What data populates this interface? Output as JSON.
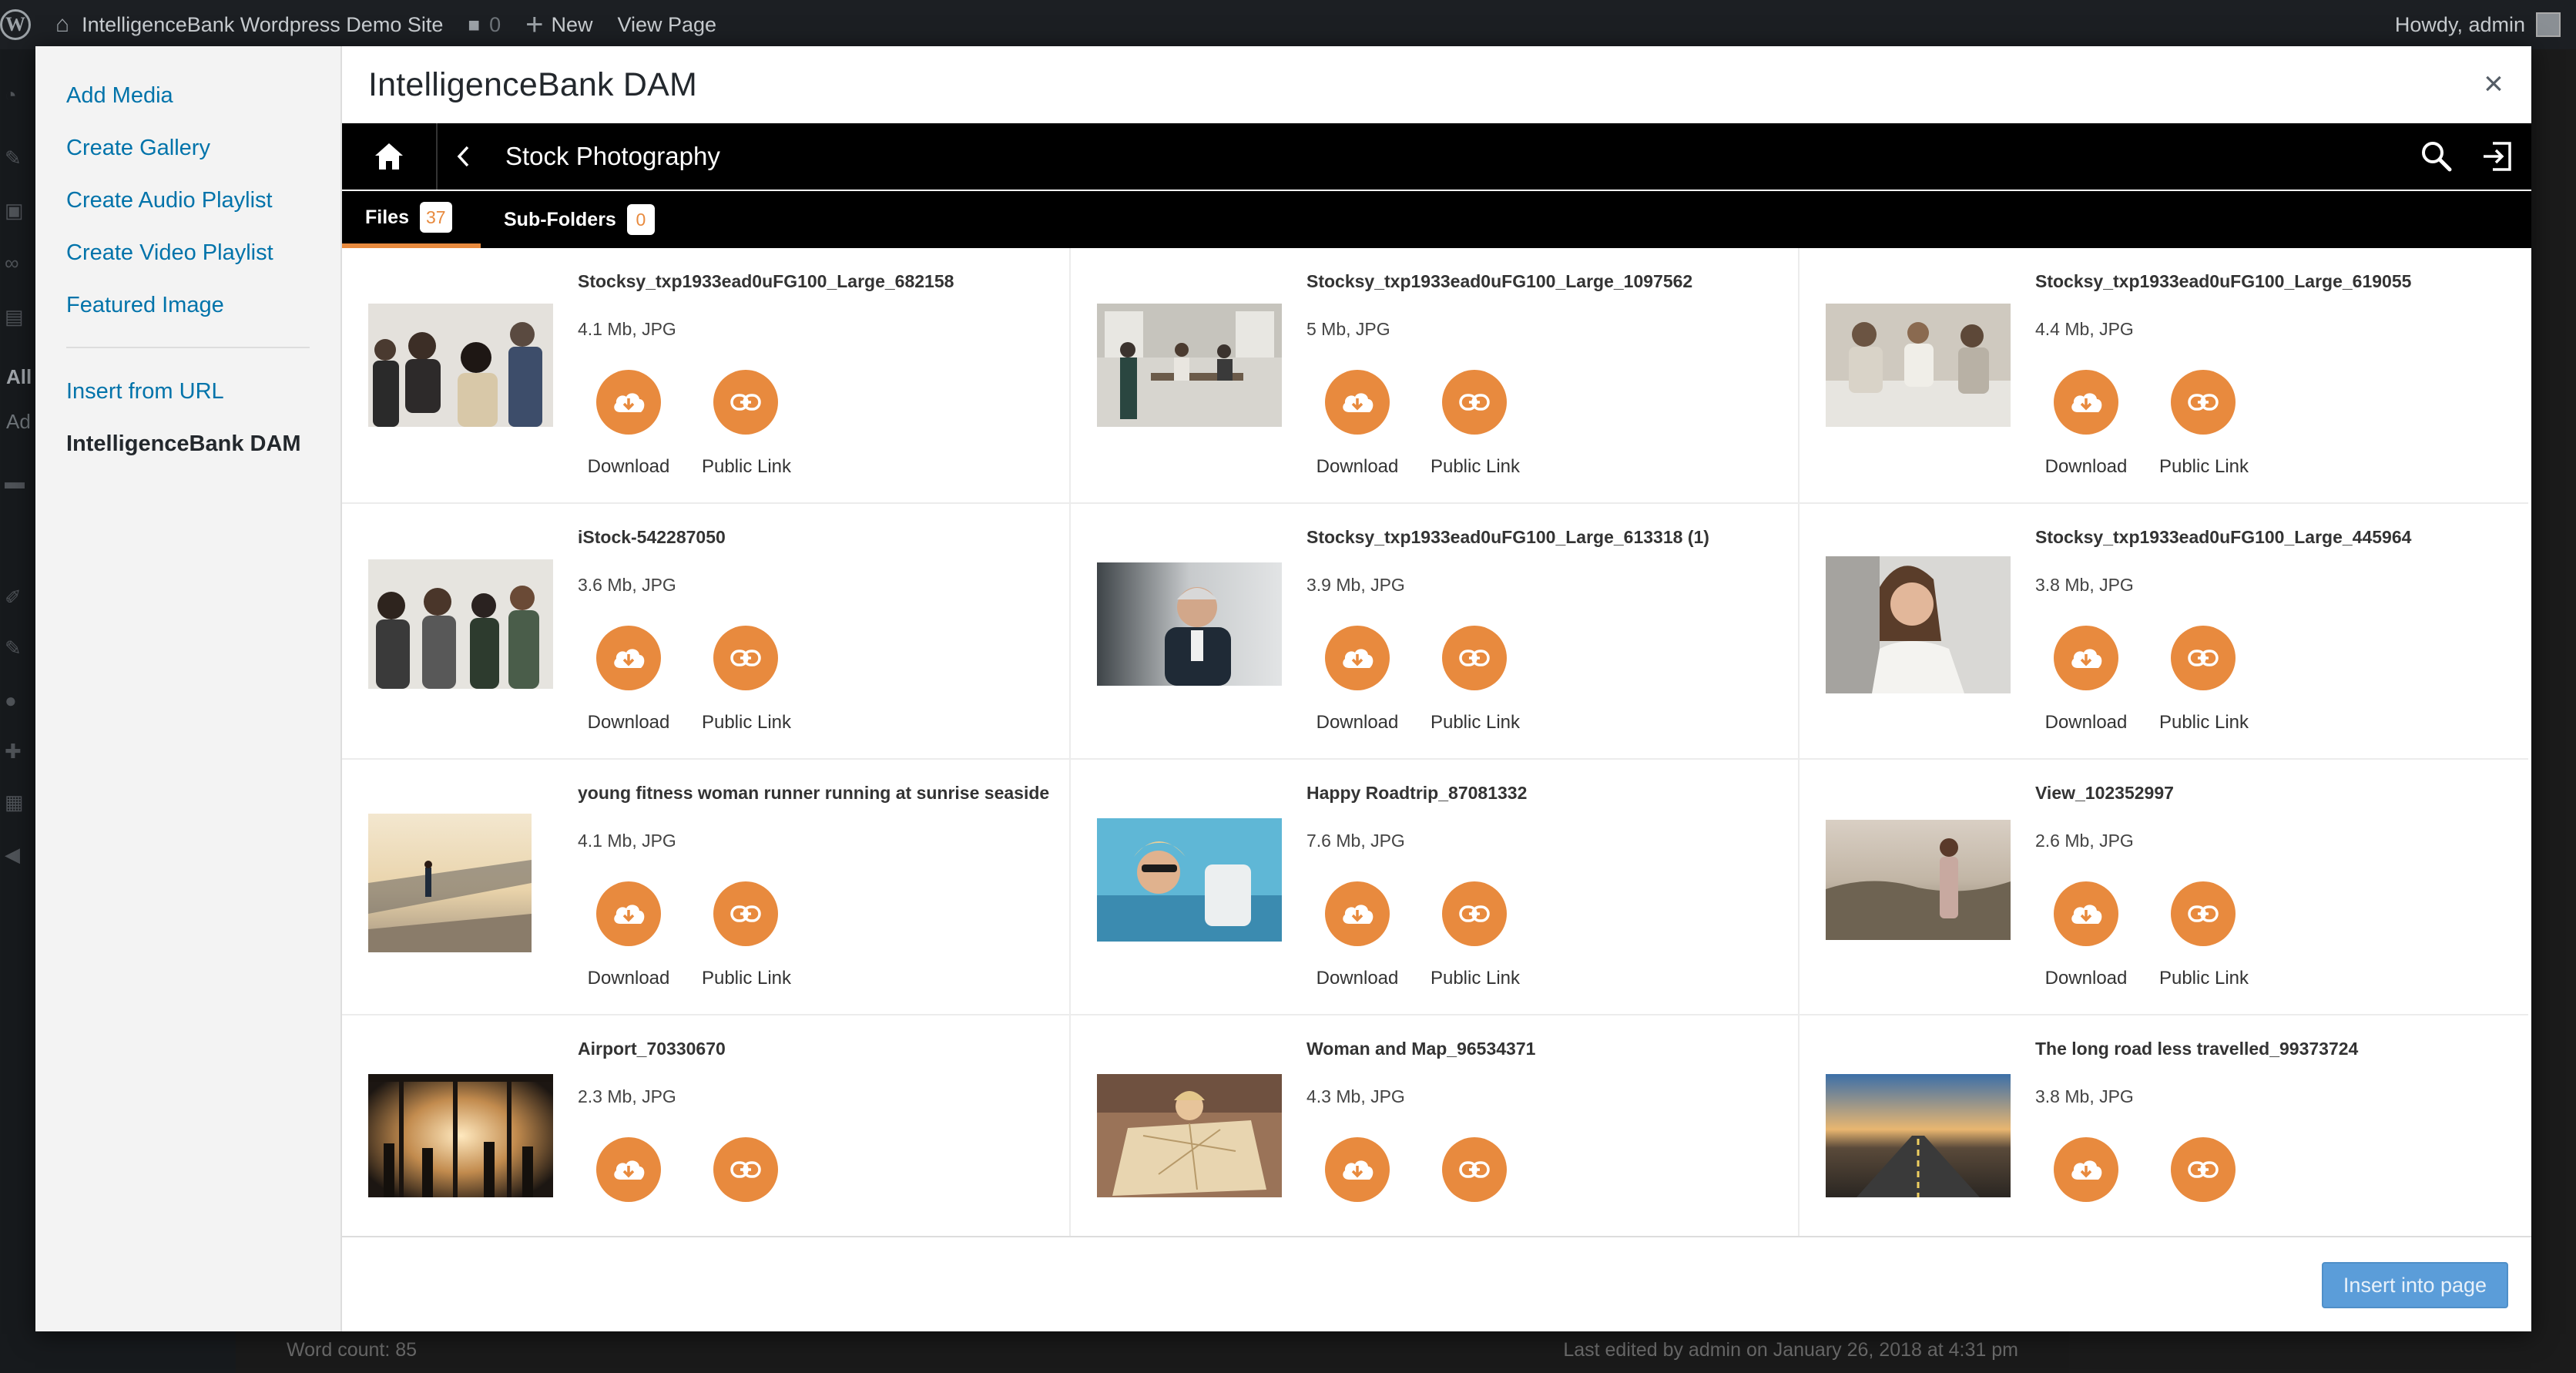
{
  "admin_bar": {
    "site_name": "IntelligenceBank Wordpress Demo Site",
    "comments_count": "0",
    "new_label": "New",
    "view_page_label": "View Page",
    "greeting": "Howdy, admin"
  },
  "menu": {
    "items": [
      {
        "label": "Add Media"
      },
      {
        "label": "Create Gallery"
      },
      {
        "label": "Create Audio Playlist"
      },
      {
        "label": "Create Video Playlist"
      },
      {
        "label": "Featured Image"
      }
    ],
    "secondary": [
      {
        "label": "Insert from URL"
      },
      {
        "label": "IntelligenceBank DAM"
      }
    ]
  },
  "frame": {
    "title": "IntelligenceBank DAM",
    "close_glyph": "×"
  },
  "ib": {
    "folder_name": "Stock Photography",
    "tabs": [
      {
        "label": "Files",
        "count": "37"
      },
      {
        "label": "Sub-Folders",
        "count": "0"
      }
    ],
    "download_label": "Download",
    "public_link_label": "Public Link",
    "accent": "#e88a3e"
  },
  "files": [
    {
      "name": "Stocksy_txp1933ead0uFG100_Large_682158",
      "meta": "4.1 Mb, JPG",
      "thumb_icon": "office-team-photo"
    },
    {
      "name": "Stocksy_txp1933ead0uFG100_Large_1097562",
      "meta": "5 Mb, JPG",
      "thumb_icon": "office-room-photo"
    },
    {
      "name": "Stocksy_txp1933ead0uFG100_Large_619055",
      "meta": "4.4 Mb, JPG",
      "thumb_icon": "meeting-photo"
    },
    {
      "name": "iStock-542287050",
      "meta": "3.6 Mb, JPG",
      "thumb_icon": "people-meeting-photo"
    },
    {
      "name": "Stocksy_txp1933ead0uFG100_Large_613318 (1)",
      "meta": "3.9 Mb, JPG",
      "thumb_icon": "businessman-photo"
    },
    {
      "name": "Stocksy_txp1933ead0uFG100_Large_445964",
      "meta": "3.8 Mb, JPG",
      "thumb_icon": "woman-portrait-photo"
    },
    {
      "name": "young fitness woman runner running at sunrise seaside",
      "meta": "4.1 Mb, JPG",
      "thumb_icon": "runner-seaside-photo"
    },
    {
      "name": "Happy Roadtrip_87081332",
      "meta": "7.6 Mb, JPG",
      "thumb_icon": "roadtrip-photo"
    },
    {
      "name": "View_102352997",
      "meta": "2.6 Mb, JPG",
      "thumb_icon": "view-photo"
    },
    {
      "name": "Airport_70330670",
      "meta": "2.3 Mb, JPG",
      "thumb_icon": "airport-photo"
    },
    {
      "name": "Woman and Map_96534371",
      "meta": "4.3 Mb, JPG",
      "thumb_icon": "woman-map-photo"
    },
    {
      "name": "The long road less travelled_99373724",
      "meta": "3.8 Mb, JPG",
      "thumb_icon": "long-road-photo"
    }
  ],
  "footer": {
    "insert_label": "Insert into page"
  },
  "background": {
    "word_count": "Word count: 85",
    "last_edited": "Last edited by admin on January 26, 2018 at 4:31 pm",
    "sidebar_fragment_1": "All",
    "sidebar_fragment_2": "Ad"
  }
}
